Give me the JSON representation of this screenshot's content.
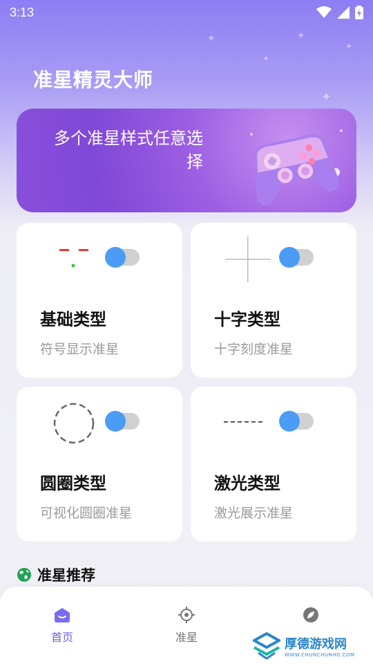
{
  "status_bar": {
    "time": "3:13"
  },
  "app": {
    "title": "准星精灵大师"
  },
  "hero": {
    "text": "多个准星样式任意选择"
  },
  "cards": [
    {
      "title": "基础类型",
      "subtitle": "符号显示准星",
      "enabled": true
    },
    {
      "title": "十字类型",
      "subtitle": "十字刻度准星",
      "enabled": true
    },
    {
      "title": "圆圈类型",
      "subtitle": "可视化圆圈准星",
      "enabled": true
    },
    {
      "title": "激光类型",
      "subtitle": "激光展示准星",
      "enabled": true
    }
  ],
  "section": {
    "title": "准星推荐"
  },
  "nav": [
    {
      "label": "首页",
      "icon": "home-icon",
      "active": true
    },
    {
      "label": "准星",
      "icon": "crosshair-icon",
      "active": false
    },
    {
      "label": "",
      "icon": "leaf-icon",
      "active": false
    }
  ],
  "watermark": {
    "main": "厚德游戏网",
    "sub": "WWW.CHUNCHUNHD.COM"
  },
  "colors": {
    "accent": "#6f62e8",
    "toggle_knob": "#4a9cf5",
    "hero": "#8a50dc"
  }
}
